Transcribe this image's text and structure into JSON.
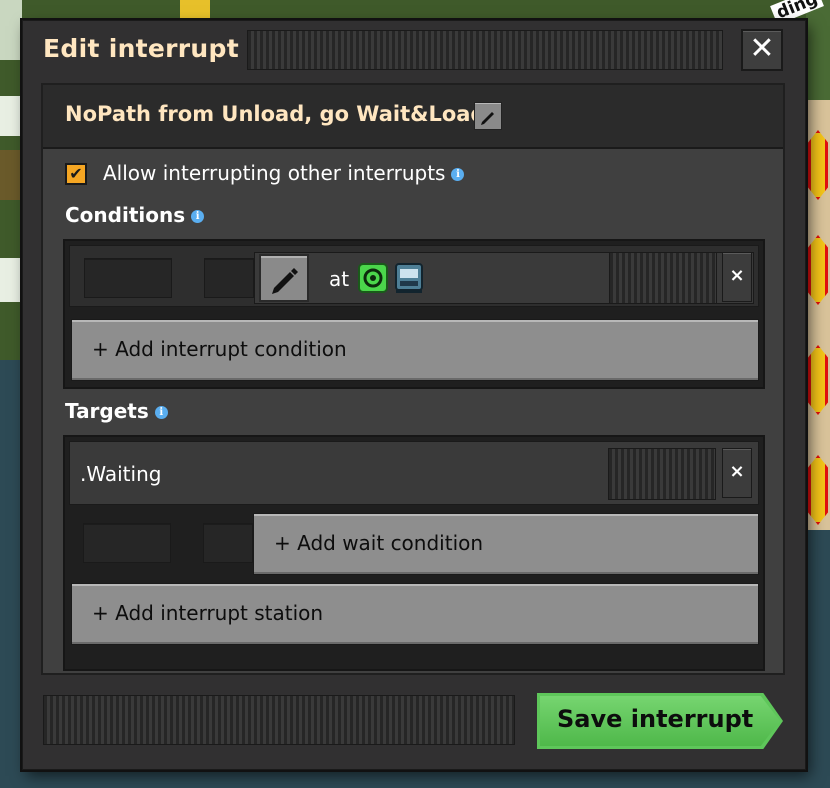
{
  "dialog": {
    "title": "Edit interrupt",
    "close_glyph": "✕",
    "interrupt_name": "NoPath from Unload, go Wait&Load",
    "allow_interrupting_label": "Allow interrupting other interrupts",
    "allow_interrupting_checked": true,
    "check_glyph": "✔",
    "info_glyph": "i",
    "conditions": {
      "label": "Conditions",
      "items": [
        {
          "text": "at",
          "icons": [
            "circuit-signal-icon",
            "train-stop-icon"
          ],
          "remove_glyph": "×"
        }
      ],
      "add_label": "+ Add interrupt condition"
    },
    "targets": {
      "label": "Targets",
      "items": [
        {
          "station": ".Waiting",
          "remove_glyph": "×",
          "add_wait_label": "+ Add wait condition"
        }
      ],
      "add_label": "+ Add interrupt station"
    },
    "save_label": "Save interrupt"
  },
  "background": {
    "corner_label": "ding"
  },
  "colors": {
    "accent_orange": "#f5a623",
    "title_text": "#ffe6c0",
    "save_green": "#5ec65a",
    "button_grey": "#8e8e8e"
  }
}
